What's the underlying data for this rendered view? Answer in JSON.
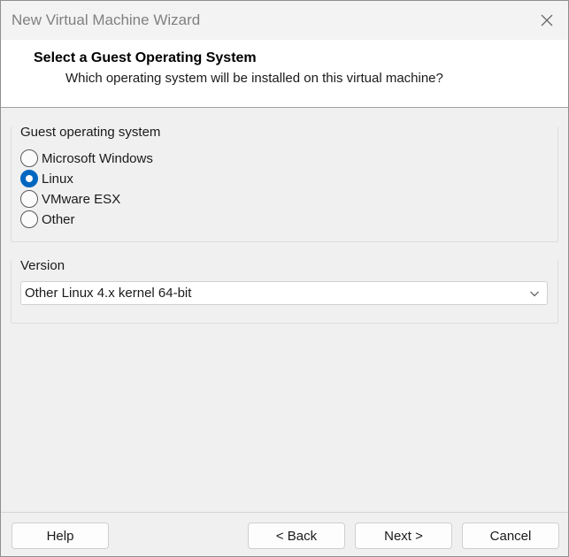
{
  "window": {
    "title": "New Virtual Machine Wizard",
    "close_icon": "close-icon"
  },
  "header": {
    "title": "Select a Guest Operating System",
    "subtitle": "Which operating system will be installed on this virtual machine?"
  },
  "guest_os": {
    "label": "Guest operating system",
    "options": [
      {
        "label": "Microsoft Windows",
        "checked": false
      },
      {
        "label": "Linux",
        "checked": true
      },
      {
        "label": "VMware ESX",
        "checked": false
      },
      {
        "label": "Other",
        "checked": false
      }
    ]
  },
  "version": {
    "label": "Version",
    "selected": "Other Linux 4.x kernel 64-bit"
  },
  "buttons": {
    "help": "Help",
    "back": "< Back",
    "next": "Next >",
    "cancel": "Cancel"
  },
  "colors": {
    "accent": "#0067c0",
    "background": "#f0f0f0"
  }
}
